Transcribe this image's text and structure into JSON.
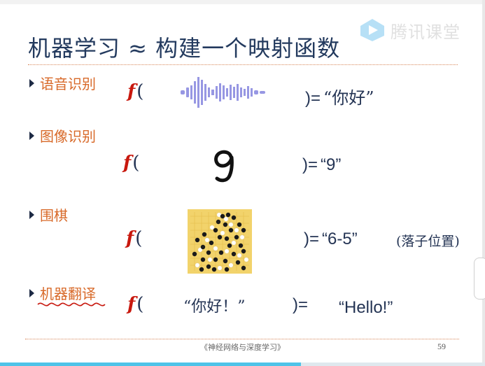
{
  "watermark": {
    "text": "腾讯课堂",
    "icon": "play-icon"
  },
  "slide": {
    "title": "机器学习 ≈ 构建一个映射函数",
    "sections": [
      {
        "label": "语音识别",
        "function_symbol": "f",
        "open_paren": "(",
        "input_kind": "waveform-image",
        "close": ")=",
        "result": "“你好”"
      },
      {
        "label": "图像识别",
        "function_symbol": "f",
        "open_paren": "(",
        "input_kind": "digit-image",
        "close": ")=",
        "result": "“9”"
      },
      {
        "label": "围棋",
        "function_symbol": "f",
        "open_paren": "(",
        "input_kind": "go-board-image",
        "close": ")=",
        "result": "“6-5”",
        "note": "(落子位置)"
      },
      {
        "label": "机器翻译",
        "function_symbol": "f",
        "open_paren": "(",
        "input_text": "“你好！”",
        "close": ")=",
        "result": "“Hello!”"
      }
    ],
    "footer": "《神经网络与深度学习》",
    "page_number": "59"
  },
  "colors": {
    "title": "#233a5e",
    "section": "#d86a2a",
    "function": "#c8180e",
    "rule": "#d8875a",
    "progress": "#4fc3e8"
  },
  "progress": {
    "fraction": 0.62
  }
}
